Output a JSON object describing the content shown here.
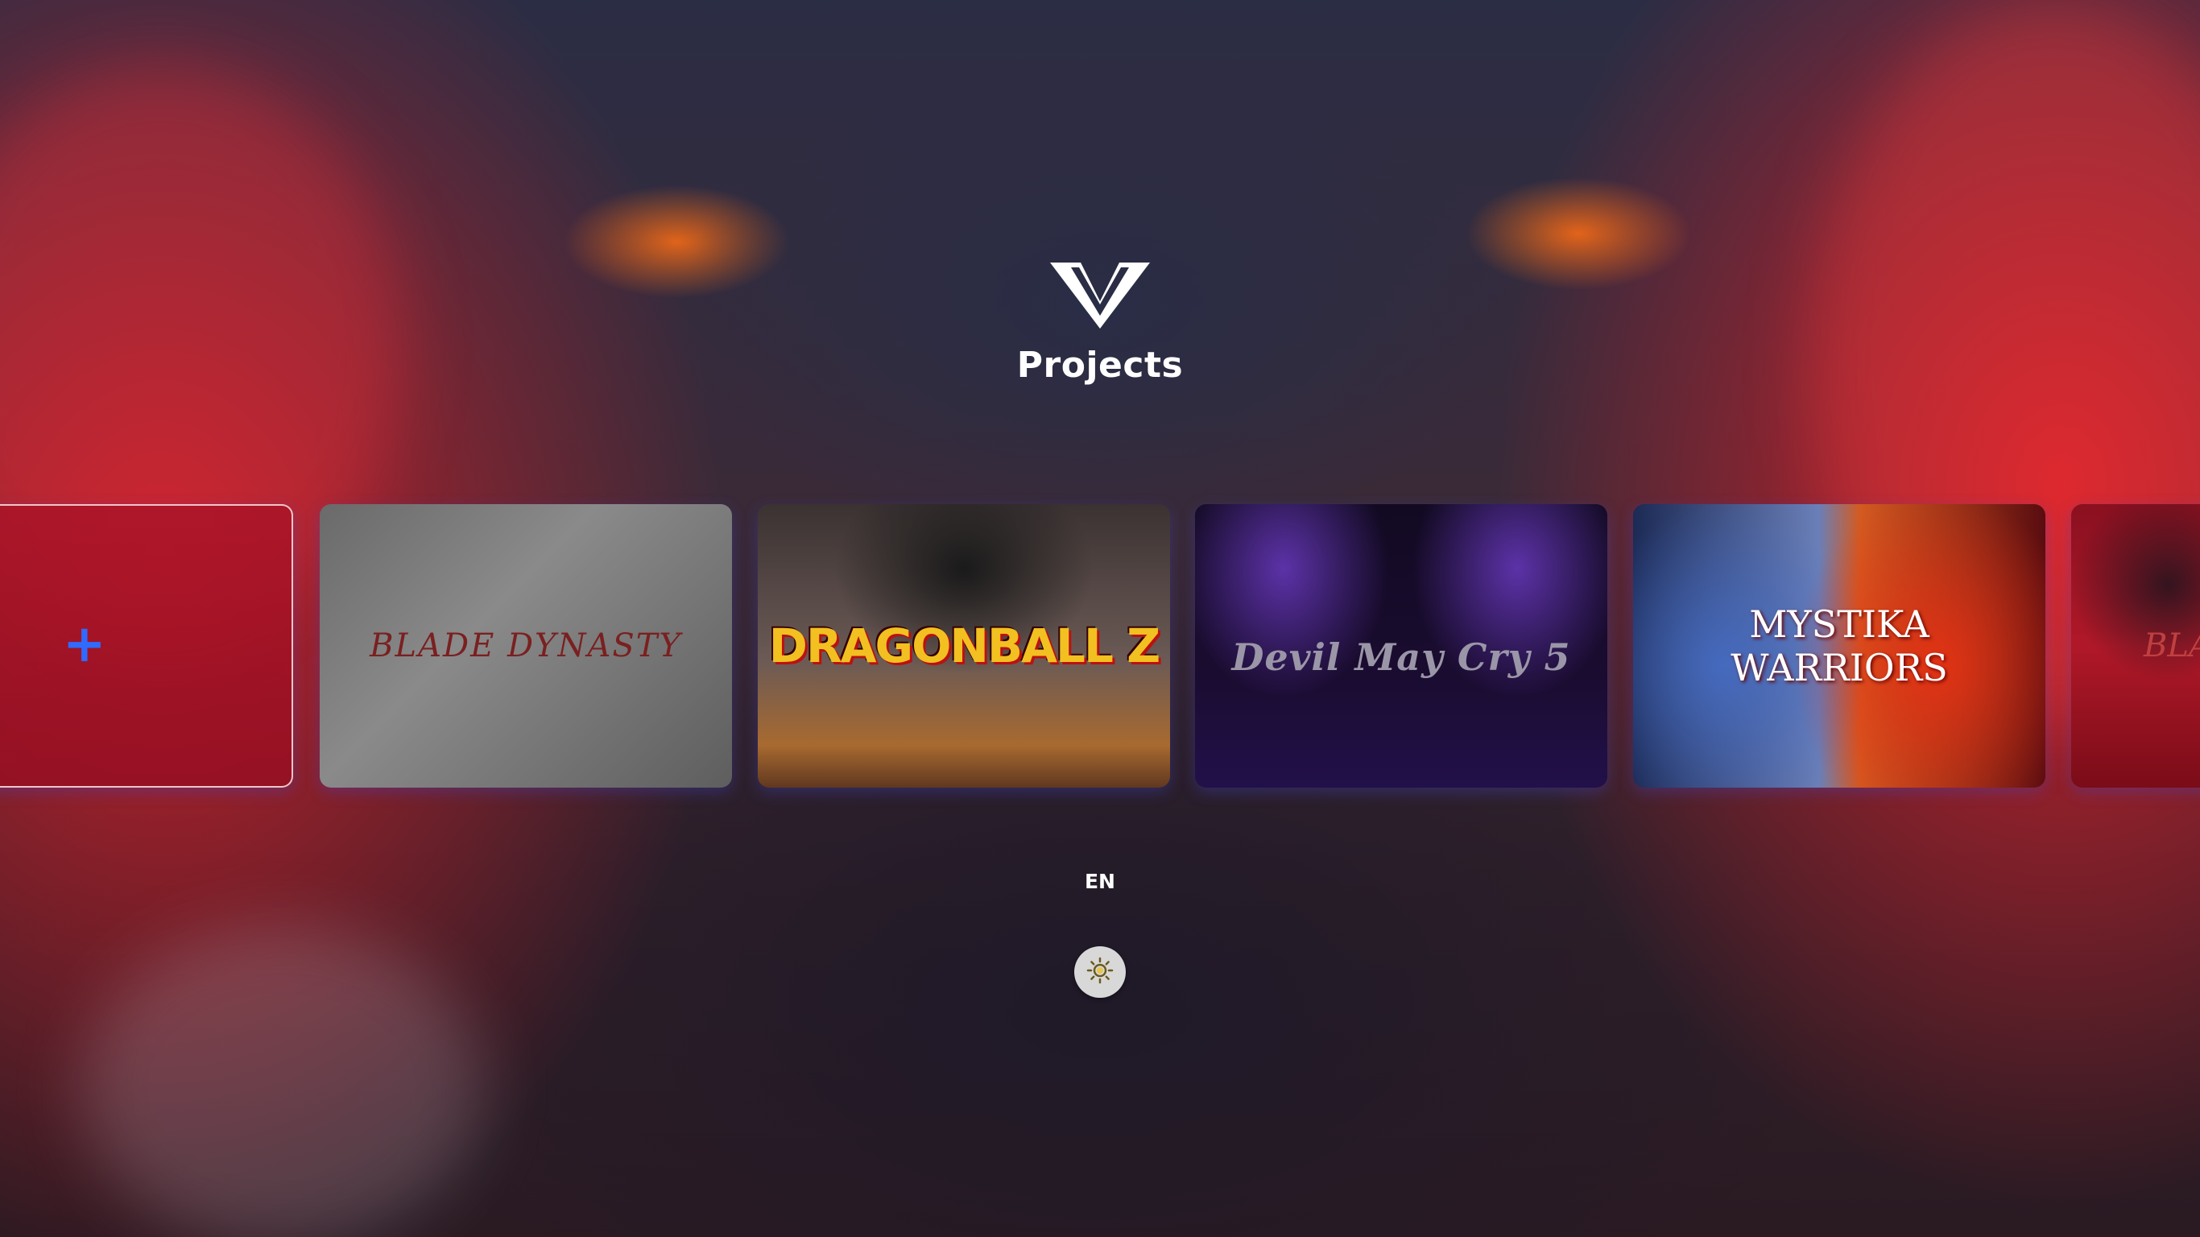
{
  "header": {
    "logo": "v-logo-icon",
    "title": "Projects"
  },
  "projects": {
    "add_button_icon": "+",
    "cards": [
      {
        "title": "BLADE DYNASTY"
      },
      {
        "title": "DRAGONBALL Z"
      },
      {
        "title": "Devil May Cry 5"
      },
      {
        "title_line1": "MYSTIKA",
        "title_line2": "WARRIORS"
      },
      {
        "title": "BLA"
      }
    ]
  },
  "footer": {
    "language": "EN",
    "theme_icon": "sun-icon"
  },
  "colors": {
    "accent": "#2f6bff",
    "title_text": "#ffffff",
    "theme_button_bg": "#d8d8d8"
  }
}
